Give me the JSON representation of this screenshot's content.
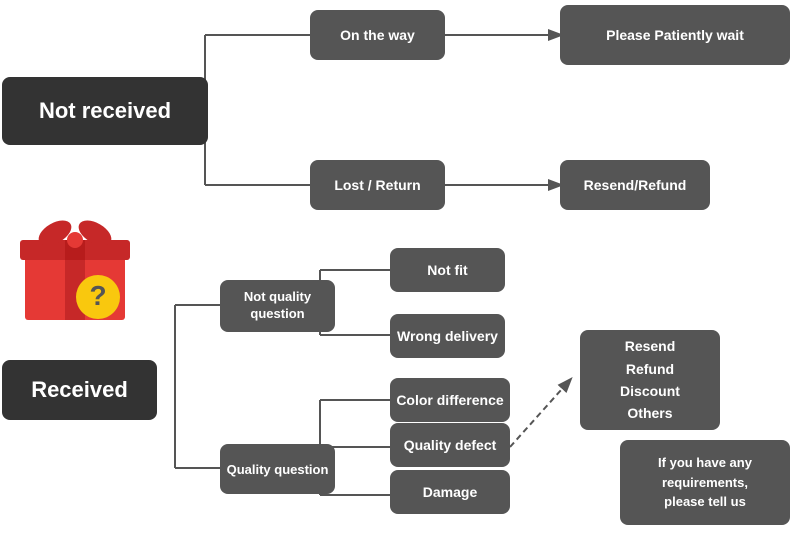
{
  "nodes": {
    "not_received": {
      "label": "Not received"
    },
    "on_the_way": {
      "label": "On the way"
    },
    "please_wait": {
      "label": "Please Patiently wait"
    },
    "lost_return": {
      "label": "Lost / Return"
    },
    "resend_refund_top": {
      "label": "Resend/Refund"
    },
    "received": {
      "label": "Received"
    },
    "not_quality": {
      "label": "Not quality\nquestion"
    },
    "quality_question": {
      "label": "Quality question"
    },
    "not_fit": {
      "label": "Not fit"
    },
    "wrong_delivery": {
      "label": "Wrong delivery"
    },
    "color_difference": {
      "label": "Color difference"
    },
    "quality_defect": {
      "label": "Quality defect"
    },
    "damage": {
      "label": "Damage"
    },
    "resend_refund_box": {
      "label": "Resend\nRefund\nDiscount\nOthers"
    },
    "if_you_have": {
      "label": "If you have any\nrequirements,\nplease tell us"
    }
  }
}
